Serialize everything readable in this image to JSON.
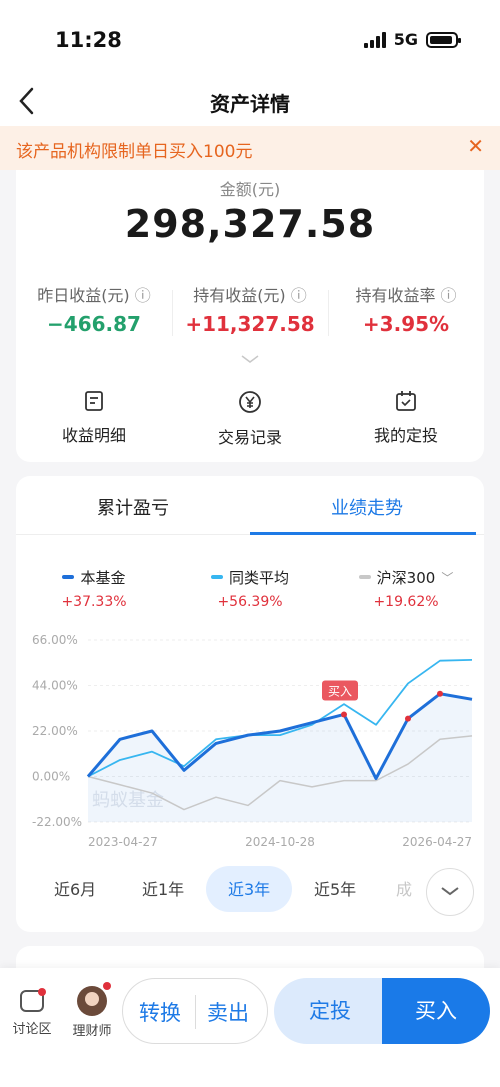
{
  "status_bar": {
    "time": "11:28",
    "network": "5G"
  },
  "nav": {
    "title": "资产详情"
  },
  "banner": {
    "text": "该产品机构限制单日买入100元"
  },
  "summary": {
    "amount_label": "金额(元)",
    "amount": "298,327.58",
    "stats": [
      {
        "label": "昨日收益(元)",
        "value": "−466.87",
        "color": "#23a06c"
      },
      {
        "label": "持有收益(元)",
        "value": "+11,327.58",
        "color": "#e0313c"
      },
      {
        "label": "持有收益率",
        "value": "+3.95%",
        "color": "#e0313c"
      }
    ],
    "actions": [
      {
        "label": "收益明细",
        "icon": "document-icon"
      },
      {
        "label": "交易记录",
        "icon": "yen-icon"
      },
      {
        "label": "我的定投",
        "icon": "calendar-icon"
      }
    ]
  },
  "performance": {
    "tabs": [
      "累计盈亏",
      "业绩走势"
    ],
    "active_tab": 1,
    "legend": [
      {
        "name": "本基金",
        "value": "+37.33%",
        "color": "#1e6fd9"
      },
      {
        "name": "同类平均",
        "value": "+56.39%",
        "color": "#37b6f0"
      },
      {
        "name": "沪深300",
        "value": "+19.62%",
        "color": "#c8c8c8"
      }
    ],
    "periods": [
      "近6月",
      "近1年",
      "近3年",
      "近5年",
      "成"
    ],
    "active_period": "近3年",
    "watermark": "蚂蚁基金",
    "buy_marker": "买入"
  },
  "chart_data": {
    "type": "line",
    "title": "",
    "xlabel": "",
    "ylabel": "",
    "x_ticks": [
      "2023-04-27",
      "2024-10-28",
      "2026-04-27"
    ],
    "y_ticks": [
      "66.00%",
      "44.00%",
      "22.00%",
      "0.00%",
      "-22.00%"
    ],
    "ylim": [
      -22,
      66
    ],
    "x": [
      "2023-04",
      "2023-07",
      "2023-10",
      "2024-01",
      "2024-04",
      "2024-07",
      "2024-10",
      "2025-01",
      "2025-04",
      "2025-07",
      "2025-10",
      "2026-01",
      "2026-04"
    ],
    "series": [
      {
        "name": "本基金",
        "values": [
          0,
          18,
          22,
          3,
          16,
          20,
          22,
          26,
          30,
          -1,
          28,
          40,
          37.33
        ]
      },
      {
        "name": "同类平均",
        "values": [
          0,
          8,
          12,
          5,
          18,
          20,
          20,
          25,
          35,
          25,
          45,
          56,
          56.39
        ]
      },
      {
        "name": "沪深300",
        "values": [
          0,
          -4,
          -8,
          -16,
          -10,
          -14,
          -2,
          -5,
          -2,
          -2,
          6,
          18,
          19.62
        ]
      }
    ]
  },
  "bottom_bar": {
    "discuss": "讨论区",
    "advisor": "理财师",
    "convert": "转换",
    "sell": "卖出",
    "fixed_invest": "定投",
    "buy": "买入"
  }
}
